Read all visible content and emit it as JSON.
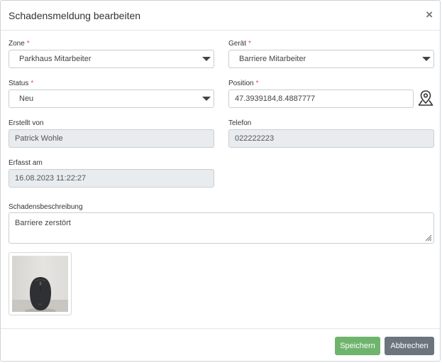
{
  "dialog": {
    "title": "Schadensmeldung bearbeiten",
    "close_symbol": "×"
  },
  "required_marker": "*",
  "fields": {
    "zone": {
      "label": "Zone",
      "value": "Parkhaus Mitarbeiter"
    },
    "geraet": {
      "label": "Gerät",
      "value": "Barriere Mitarbeiter"
    },
    "status": {
      "label": "Status",
      "value": "Neu"
    },
    "position": {
      "label": "Position",
      "value": "47.3939184,8.4887777"
    },
    "erstellt_von": {
      "label": "Erstellt von",
      "value": "Patrick Wohle"
    },
    "telefon": {
      "label": "Telefon",
      "value": "022222223"
    },
    "erfasst_am": {
      "label": "Erfasst am",
      "value": "16.08.2023 11:22:27"
    },
    "schadensbeschreibung": {
      "label": "Schadensbeschreibung",
      "value": "Barriere zerstört"
    }
  },
  "icons": {
    "dropdown": "chevron-down-icon",
    "map_pin": "map-pin-icon",
    "close": "close-icon",
    "resize": "resize-grip-icon"
  },
  "buttons": {
    "save": "Speichern",
    "cancel": "Abbrechen"
  },
  "colors": {
    "save_button": "#6fb46d",
    "cancel_button": "#6c757d",
    "required": "#d9534f",
    "readonly_bg": "#e9ecef"
  }
}
